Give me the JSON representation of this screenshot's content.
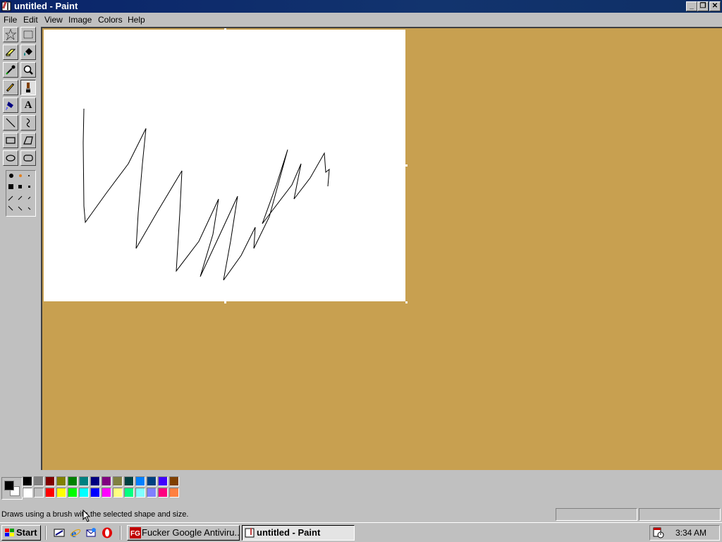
{
  "window": {
    "title": "untitled - Paint",
    "minimize_label": "_",
    "maximize_label": "❐",
    "close_label": "✕"
  },
  "menu": {
    "items": [
      {
        "label": "File"
      },
      {
        "label": "Edit"
      },
      {
        "label": "View"
      },
      {
        "label": "Image"
      },
      {
        "label": "Colors"
      },
      {
        "label": "Help"
      }
    ]
  },
  "toolbox": {
    "tools": [
      {
        "name": "free-form-select",
        "icon": "star-select-icon"
      },
      {
        "name": "select",
        "icon": "rect-select-icon"
      },
      {
        "name": "eraser",
        "icon": "eraser-icon"
      },
      {
        "name": "fill-with-color",
        "icon": "paint-bucket-icon"
      },
      {
        "name": "pick-color",
        "icon": "eyedropper-icon"
      },
      {
        "name": "magnifier",
        "icon": "magnifier-icon"
      },
      {
        "name": "pencil",
        "icon": "pencil-icon"
      },
      {
        "name": "brush",
        "icon": "brush-icon",
        "pressed": true
      },
      {
        "name": "airbrush",
        "icon": "airbrush-icon"
      },
      {
        "name": "text",
        "icon": "text-icon",
        "glyph": "A"
      },
      {
        "name": "line",
        "icon": "line-icon"
      },
      {
        "name": "curve",
        "icon": "curve-icon"
      },
      {
        "name": "rectangle",
        "icon": "rectangle-icon"
      },
      {
        "name": "polygon",
        "icon": "polygon-icon"
      },
      {
        "name": "ellipse",
        "icon": "ellipse-icon"
      },
      {
        "name": "rounded-rectangle",
        "icon": "rounded-rectangle-icon"
      }
    ]
  },
  "palette": {
    "foreground": "#000000",
    "background": "#ffffff",
    "top_row": [
      "#000000",
      "#808080",
      "#800000",
      "#808000",
      "#008000",
      "#008080",
      "#000080",
      "#800080",
      "#808040",
      "#004040",
      "#0080ff",
      "#004080",
      "#4000ff",
      "#804000"
    ],
    "bottom_row": [
      "#ffffff",
      "#c0c0c0",
      "#ff0000",
      "#ffff00",
      "#00ff00",
      "#00ffff",
      "#0000ff",
      "#ff00ff",
      "#ffff80",
      "#00ff80",
      "#80ffff",
      "#8080ff",
      "#ff0080",
      "#ff8040"
    ]
  },
  "workspace": {
    "background": "#c8a050"
  },
  "status": {
    "text": "Draws using a brush with the selected shape and size."
  },
  "taskbar": {
    "start_label": "Start",
    "quick_launch": [
      "show-desktop-icon",
      "internet-explorer-icon",
      "outlook-express-icon",
      "opera-icon"
    ],
    "tasks": [
      {
        "label": "Fucker Google Antiviru...",
        "icon": "fg-app-icon",
        "active": false
      },
      {
        "label": "untitled - Paint",
        "icon": "paint-app-icon",
        "active": true
      }
    ],
    "clock": "3:34 AM"
  }
}
